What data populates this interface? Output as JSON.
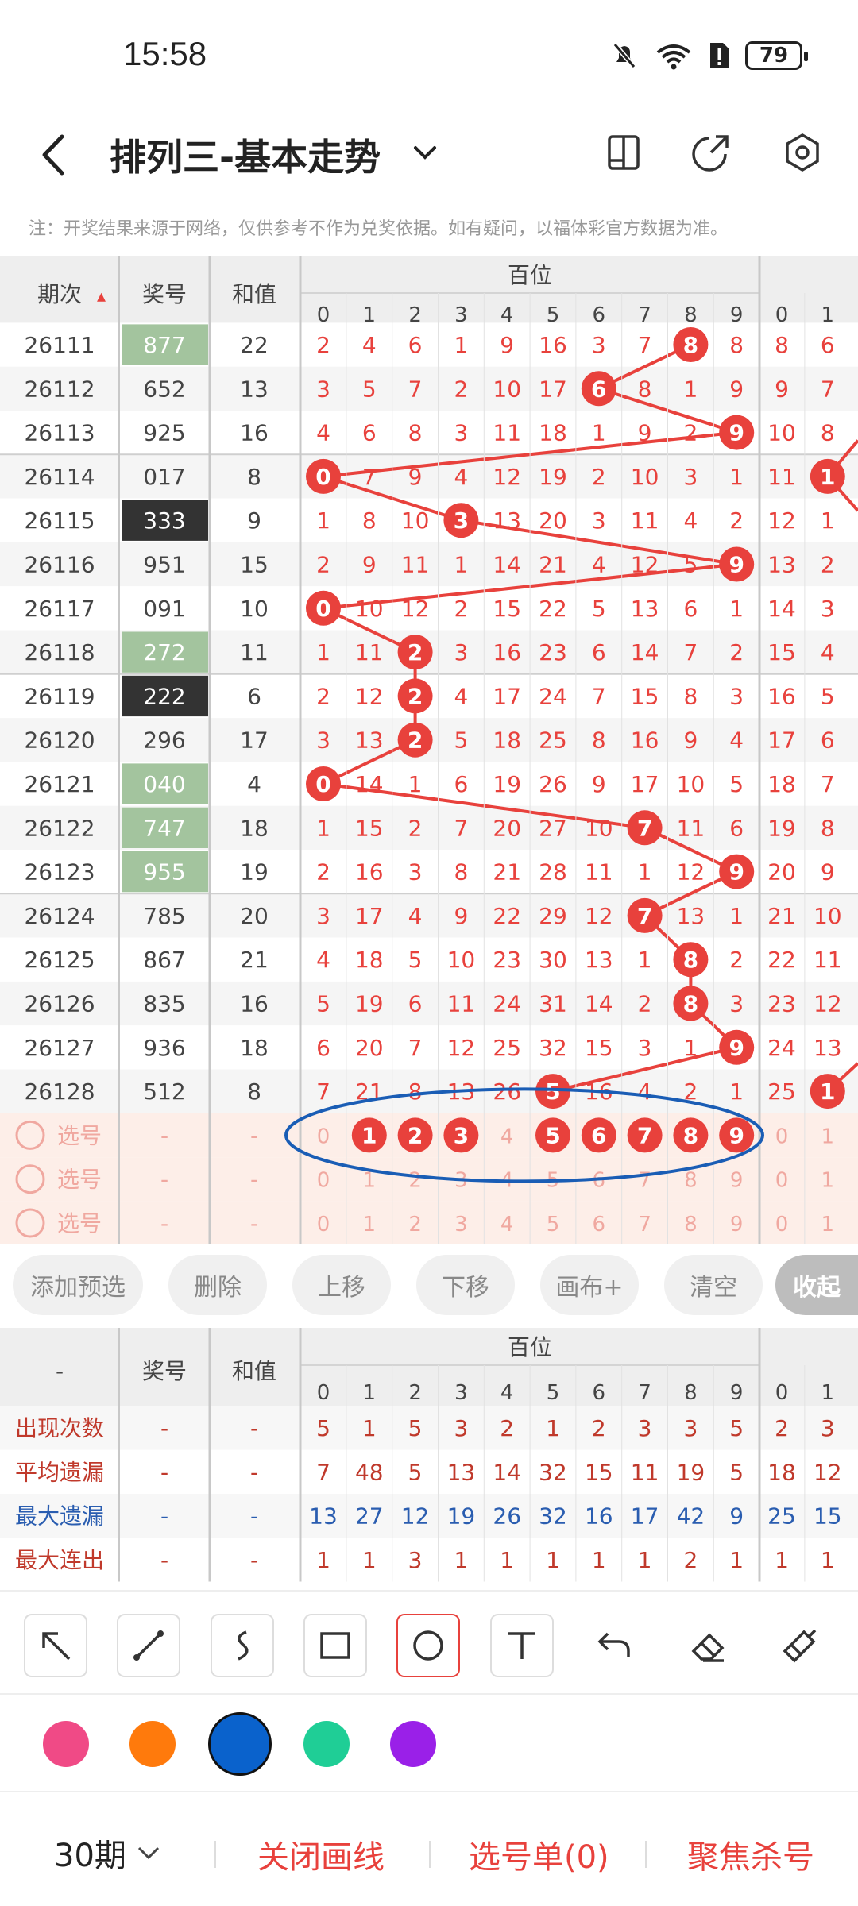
{
  "status": {
    "time": "15:58",
    "battery": "79"
  },
  "header": {
    "title": "排列三-基本走势",
    "back_icon": "chevron-left-icon"
  },
  "notice": "注：开奖结果来源于网络，仅供参考不作为兑奖依据。如有疑问，以福体彩官方数据为准。",
  "table": {
    "col_period": "期次",
    "col_number": "奖号",
    "col_sum": "和值",
    "group_hundreds": "百位",
    "digits": [
      "0",
      "1",
      "2",
      "3",
      "4",
      "5",
      "6",
      "7",
      "8",
      "9"
    ],
    "next_digits": [
      "0",
      "1"
    ],
    "rows": [
      {
        "period": "26111",
        "number": "877",
        "sum": "22",
        "style": "green",
        "vals": [
          2,
          4,
          6,
          1,
          9,
          16,
          3,
          7,
          8,
          8
        ],
        "hit": 8,
        "next": [
          8,
          6
        ]
      },
      {
        "period": "26112",
        "number": "652",
        "sum": "13",
        "style": "",
        "vals": [
          3,
          5,
          7,
          2,
          10,
          17,
          6,
          8,
          1,
          9
        ],
        "hit": 6,
        "next": [
          9,
          7
        ]
      },
      {
        "period": "26113",
        "number": "925",
        "sum": "16",
        "style": "",
        "vals": [
          4,
          6,
          8,
          3,
          11,
          18,
          1,
          9,
          2,
          9
        ],
        "hit": 9,
        "next": [
          10,
          8
        ]
      },
      {
        "period": "26114",
        "number": "017",
        "sum": "8",
        "style": "",
        "vals": [
          0,
          7,
          9,
          4,
          12,
          19,
          2,
          10,
          3,
          1
        ],
        "hit": 0,
        "next": [
          11,
          1
        ],
        "next_hit": 1
      },
      {
        "period": "26115",
        "number": "333",
        "sum": "9",
        "style": "dark",
        "vals": [
          1,
          8,
          10,
          3,
          13,
          20,
          3,
          11,
          4,
          2
        ],
        "hit": 3,
        "next": [
          12,
          1
        ]
      },
      {
        "period": "26116",
        "number": "951",
        "sum": "15",
        "style": "",
        "vals": [
          2,
          9,
          11,
          1,
          14,
          21,
          4,
          12,
          5,
          9
        ],
        "hit": 9,
        "next": [
          13,
          2
        ]
      },
      {
        "period": "26117",
        "number": "091",
        "sum": "10",
        "style": "",
        "vals": [
          0,
          10,
          12,
          2,
          15,
          22,
          5,
          13,
          6,
          1
        ],
        "hit": 0,
        "next": [
          14,
          3
        ]
      },
      {
        "period": "26118",
        "number": "272",
        "sum": "11",
        "style": "green",
        "vals": [
          1,
          11,
          2,
          3,
          16,
          23,
          6,
          14,
          7,
          2
        ],
        "hit": 2,
        "next": [
          15,
          4
        ]
      },
      {
        "period": "26119",
        "number": "222",
        "sum": "6",
        "style": "dark",
        "vals": [
          2,
          12,
          2,
          4,
          17,
          24,
          7,
          15,
          8,
          3
        ],
        "hit": 2,
        "next": [
          16,
          5
        ]
      },
      {
        "period": "26120",
        "number": "296",
        "sum": "17",
        "style": "",
        "vals": [
          3,
          13,
          2,
          5,
          18,
          25,
          8,
          16,
          9,
          4
        ],
        "hit": 2,
        "next": [
          17,
          6
        ]
      },
      {
        "period": "26121",
        "number": "040",
        "sum": "4",
        "style": "green",
        "vals": [
          0,
          14,
          1,
          6,
          19,
          26,
          9,
          17,
          10,
          5
        ],
        "hit": 0,
        "next": [
          18,
          7
        ]
      },
      {
        "period": "26122",
        "number": "747",
        "sum": "18",
        "style": "green",
        "vals": [
          1,
          15,
          2,
          7,
          20,
          27,
          10,
          7,
          11,
          6
        ],
        "hit": 7,
        "next": [
          19,
          8
        ]
      },
      {
        "period": "26123",
        "number": "955",
        "sum": "19",
        "style": "green",
        "vals": [
          2,
          16,
          3,
          8,
          21,
          28,
          11,
          1,
          12,
          9
        ],
        "hit": 9,
        "next": [
          20,
          9
        ]
      },
      {
        "period": "26124",
        "number": "785",
        "sum": "20",
        "style": "",
        "vals": [
          3,
          17,
          4,
          9,
          22,
          29,
          12,
          7,
          13,
          1
        ],
        "hit": 7,
        "next": [
          21,
          10
        ]
      },
      {
        "period": "26125",
        "number": "867",
        "sum": "21",
        "style": "",
        "vals": [
          4,
          18,
          5,
          10,
          23,
          30,
          13,
          1,
          8,
          2
        ],
        "hit": 8,
        "next": [
          22,
          11
        ]
      },
      {
        "period": "26126",
        "number": "835",
        "sum": "16",
        "style": "",
        "vals": [
          5,
          19,
          6,
          11,
          24,
          31,
          14,
          2,
          8,
          3
        ],
        "hit": 8,
        "next": [
          23,
          12
        ]
      },
      {
        "period": "26127",
        "number": "936",
        "sum": "18",
        "style": "",
        "vals": [
          6,
          20,
          7,
          12,
          25,
          32,
          15,
          3,
          1,
          9
        ],
        "hit": 9,
        "next": [
          24,
          13
        ]
      },
      {
        "period": "26128",
        "number": "512",
        "sum": "8",
        "style": "",
        "vals": [
          7,
          21,
          8,
          13,
          26,
          5,
          16,
          4,
          2,
          1
        ],
        "hit": 5,
        "next": [
          25,
          1
        ],
        "next_hit": 1
      }
    ],
    "select_label": "选号",
    "dash": "-",
    "select_rows": [
      {
        "selected": [
          1,
          2,
          3,
          5,
          6,
          7,
          8,
          9
        ]
      },
      {
        "selected": []
      },
      {
        "selected": []
      }
    ]
  },
  "actions": [
    "添加预选",
    "删除",
    "上移",
    "下移",
    "画布+",
    "清空",
    "收起"
  ],
  "stats": {
    "corner": "-",
    "col_number": "奖号",
    "col_sum": "和值",
    "group_hundreds": "百位",
    "rows": [
      {
        "label": "出现次数",
        "color": "#c0392b",
        "vals": [
          5,
          1,
          5,
          3,
          2,
          1,
          2,
          3,
          3,
          5
        ],
        "next": [
          2,
          3
        ]
      },
      {
        "label": "平均遗漏",
        "color": "#c0392b",
        "vals": [
          7,
          48,
          5,
          13,
          14,
          32,
          15,
          11,
          19,
          5
        ],
        "next": [
          18,
          12
        ]
      },
      {
        "label": "最大遗漏",
        "color": "#2a5db0",
        "vals": [
          13,
          27,
          12,
          19,
          26,
          32,
          16,
          17,
          42,
          9
        ],
        "next": [
          25,
          15
        ]
      },
      {
        "label": "最大连出",
        "color": "#c0392b",
        "vals": [
          1,
          1,
          3,
          1,
          1,
          1,
          1,
          1,
          2,
          1
        ],
        "next": [
          1,
          1
        ]
      }
    ]
  },
  "tools": [
    "arrow-tool-icon",
    "line-tool-icon",
    "curve-tool-icon",
    "rectangle-tool-icon",
    "circle-tool-icon",
    "text-tool-icon",
    "undo-icon",
    "eraser-icon",
    "clear-brush-icon"
  ],
  "colors": {
    "swatches": [
      "#f04a86",
      "#ff7a0c",
      "#0a62cc",
      "#1fce96",
      "#9a20e8"
    ],
    "selected_index": 2,
    "red": "#e8413c",
    "blue_oval": "#1a5db5"
  },
  "bottom": {
    "periods": "30期",
    "close_line": "关闭画线",
    "ticket": "选号单(0)",
    "focus": "聚焦杀号"
  }
}
